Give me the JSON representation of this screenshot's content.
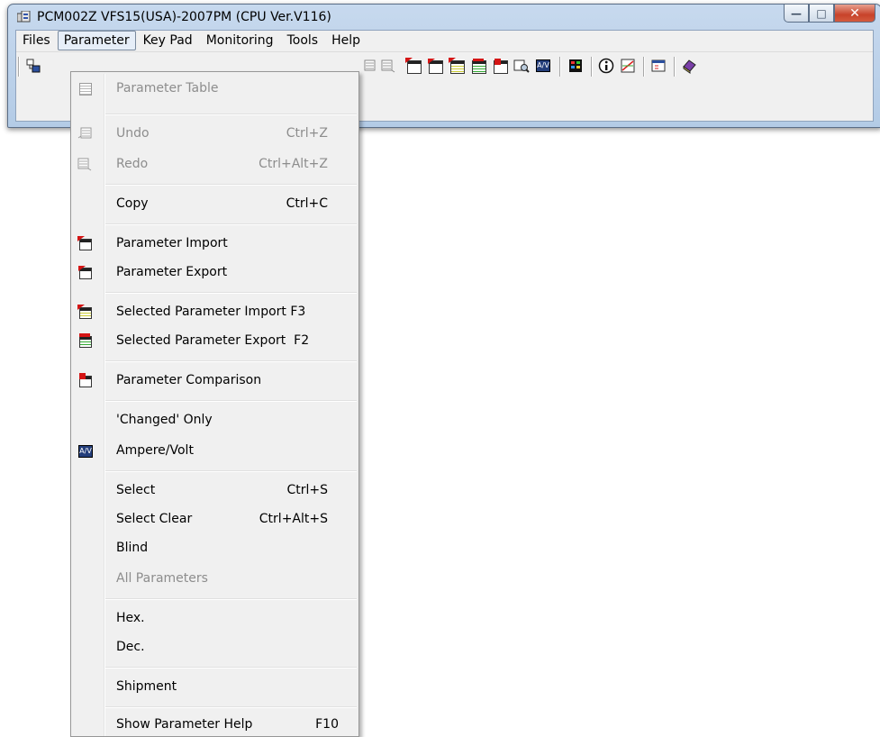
{
  "window": {
    "title": "PCM002Z VFS15(USA)-2007PM (CPU Ver.V116)",
    "buttons": [
      "minimize",
      "maximize",
      "close"
    ]
  },
  "menubar": {
    "items": [
      "Files",
      "Parameter",
      "Key Pad",
      "Monitoring",
      "Tools",
      "Help"
    ],
    "active": "Parameter"
  },
  "toolbar": {
    "icons": [
      "connect-icon",
      "undo-icon",
      "redo-icon",
      "parameter-import-icon",
      "parameter-export-icon",
      "selected-import-icon",
      "selected-export-icon",
      "parameter-comparison-icon",
      "find-icon",
      "ampere-volt-icon",
      "monitor-icon",
      "info-icon",
      "chart-icon",
      "window-icon",
      "book-icon"
    ]
  },
  "dropdown": {
    "items": [
      {
        "label": "Parameter Table",
        "shortcut": "",
        "disabled": true,
        "icon": "table-icon"
      },
      {
        "label": "Undo",
        "shortcut": "Ctrl+Z",
        "disabled": true,
        "icon": "undo-icon"
      },
      {
        "label": "Redo",
        "shortcut": "Ctrl+Alt+Z",
        "disabled": true,
        "icon": "redo-icon"
      },
      {
        "label": "Copy",
        "shortcut": "Ctrl+C",
        "disabled": false,
        "icon": ""
      },
      {
        "label": "Parameter Import",
        "shortcut": "",
        "disabled": false,
        "icon": "parameter-import-icon"
      },
      {
        "label": "Parameter Export",
        "shortcut": "",
        "disabled": false,
        "icon": "parameter-export-icon"
      },
      {
        "label": "Selected Parameter Import F3",
        "shortcut": "",
        "disabled": false,
        "icon": "selected-import-icon"
      },
      {
        "label": "Selected Parameter Export  F2",
        "shortcut": "",
        "disabled": false,
        "icon": "selected-export-icon"
      },
      {
        "label": "Parameter Comparison",
        "shortcut": "",
        "disabled": false,
        "icon": "parameter-comparison-icon"
      },
      {
        "label": "'Changed' Only",
        "shortcut": "",
        "disabled": false,
        "icon": ""
      },
      {
        "label": "Ampere/Volt",
        "shortcut": "",
        "disabled": false,
        "icon": "ampere-volt-icon"
      },
      {
        "label": "Select",
        "shortcut": "Ctrl+S",
        "disabled": false,
        "icon": ""
      },
      {
        "label": "Select Clear",
        "shortcut": "Ctrl+Alt+S",
        "disabled": false,
        "icon": ""
      },
      {
        "label": "Blind",
        "shortcut": "",
        "disabled": false,
        "icon": ""
      },
      {
        "label": "All Parameters",
        "shortcut": "",
        "disabled": true,
        "icon": ""
      },
      {
        "label": "Hex.",
        "shortcut": "",
        "disabled": false,
        "icon": ""
      },
      {
        "label": "Dec.",
        "shortcut": "",
        "disabled": false,
        "icon": ""
      },
      {
        "label": "Shipment",
        "shortcut": "",
        "disabled": false,
        "icon": ""
      },
      {
        "label": "Show Parameter Help",
        "shortcut": "F10",
        "disabled": false,
        "icon": ""
      }
    ],
    "av_icon_text": "A/V"
  }
}
